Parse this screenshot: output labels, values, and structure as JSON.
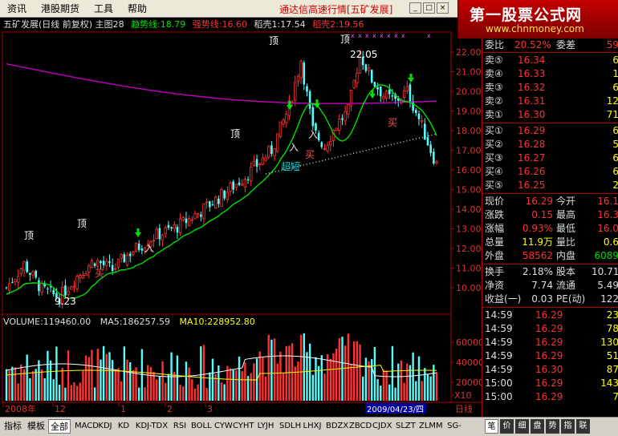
{
  "menu": {
    "items": [
      "资讯",
      "港股期货",
      "工具",
      "帮助"
    ],
    "title": "通达信高速行情[五矿发展]"
  },
  "logo": {
    "line1": "第一股票公式网",
    "line2": "www.chnmoney.com"
  },
  "chart_info": {
    "name": "五矿发展(日线 前复权) 主图28",
    "trend": "趋势线:18.79",
    "strong": "强势线:16.60",
    "rice1": "稻壳1:17.54",
    "rice2": "稻壳2:19.56"
  },
  "annotations": {
    "ding": "顶",
    "buy": "买",
    "ru": "入",
    "chao": "超短",
    "high_label": "22.05",
    "low_label": "9.23"
  },
  "axis": {
    "price_ticks": [
      "22.00",
      "21.00",
      "20.00",
      "19.00",
      "18.00",
      "17.00",
      "16.00",
      "15.00",
      "14.00",
      "13.00",
      "12.00",
      "11.00",
      "10.00"
    ],
    "vol_ticks": [
      "60000",
      "40000",
      "20000",
      "X10"
    ],
    "date_labels": [
      "2008年",
      "12",
      "1",
      "2",
      "3"
    ],
    "date_box": "2009/04/23/四",
    "period": "日线"
  },
  "volume_info": {
    "vol": "VOLUME:119460.00",
    "ma5": "MA5:186257.59",
    "ma10": "MA10:228952.80"
  },
  "quote": {
    "header": {
      "label": "委比",
      "value": "20.52%",
      "label2": "委差",
      "value2": "59"
    },
    "asks": [
      {
        "label": "卖⑤",
        "price": "16.34",
        "vol": "6"
      },
      {
        "label": "卖④",
        "price": "16.33",
        "vol": "1"
      },
      {
        "label": "卖③",
        "price": "16.32",
        "vol": "6"
      },
      {
        "label": "卖②",
        "price": "16.31",
        "vol": "12"
      },
      {
        "label": "卖①",
        "price": "16.30",
        "vol": "71"
      }
    ],
    "bids": [
      {
        "label": "买①",
        "price": "16.29",
        "vol": "6"
      },
      {
        "label": "买②",
        "price": "16.28",
        "vol": "5"
      },
      {
        "label": "买③",
        "price": "16.27",
        "vol": "6"
      },
      {
        "label": "买④",
        "price": "16.26",
        "vol": "6"
      },
      {
        "label": "买⑤",
        "price": "16.25",
        "vol": "2"
      }
    ],
    "stats": [
      {
        "l1": "现价",
        "v1": "16.29",
        "l2": "今开",
        "v2": "16.1"
      },
      {
        "l1": "涨跌",
        "v1": "0.15",
        "l2": "最高",
        "v2": "16.3"
      },
      {
        "l1": "涨幅",
        "v1": "0.93%",
        "l2": "最低",
        "v2": "16.0"
      },
      {
        "l1": "总量",
        "v1": "11.9万",
        "l2": "量比",
        "v2": "0.6"
      },
      {
        "l1": "外盘",
        "v1": "58562",
        "l2": "内盘",
        "v2": "6089"
      }
    ],
    "stats2": [
      {
        "l1": "换手",
        "v1": "2.18%",
        "l2": "股本",
        "v2": "10.71"
      },
      {
        "l1": "净资",
        "v1": "7.74",
        "l2": "流通",
        "v2": "5.49"
      },
      {
        "l1": "收益(一)",
        "v1": "0.03",
        "l2": "PE(动)",
        "v2": "122"
      }
    ],
    "ticks": [
      {
        "t": "14:59",
        "p": "16.29",
        "v": "23"
      },
      {
        "t": "14:59",
        "p": "16.29",
        "v": "78"
      },
      {
        "t": "14:59",
        "p": "16.29",
        "v": "130"
      },
      {
        "t": "14:59",
        "p": "16.29",
        "v": "51"
      },
      {
        "t": "14:59",
        "p": "16.30",
        "v": "87"
      },
      {
        "t": "15:00",
        "p": "16.29",
        "v": "143"
      },
      {
        "t": "15:00",
        "p": "16.29",
        "v": "7"
      }
    ]
  },
  "tabs": {
    "left": [
      "指标",
      "模板",
      "全部"
    ],
    "items": [
      "MACD",
      "KDJ",
      "KD",
      "KDJ-TDX",
      "RSI",
      "BOLL",
      "CYW",
      "CYHT",
      "LYJH",
      "SDLH",
      "LHXJ",
      "BDZX",
      "ZBCD",
      "CJDX",
      "SLZT",
      "ZLMM",
      "SG-LB"
    ],
    "right": [
      "笔",
      "价",
      "细",
      "盘",
      "势",
      "指",
      "联"
    ]
  },
  "colors": {
    "up": "#ff3232",
    "down": "#54fcfc",
    "trend": "#00e000",
    "ma_long": "#c000c0",
    "yellow": "#ffff00",
    "cyan": "#00e0e0"
  }
}
